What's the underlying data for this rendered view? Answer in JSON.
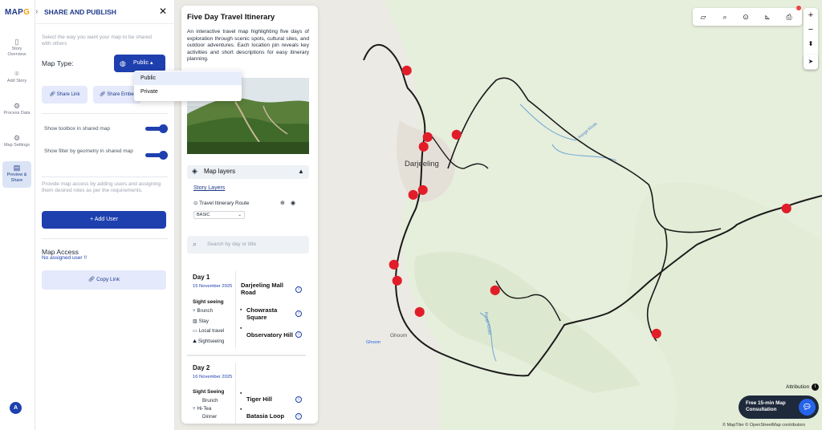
{
  "app": {
    "logo_main": "MAP",
    "logo_g": "G"
  },
  "rail": {
    "items": [
      {
        "icon": "book-icon",
        "label": "Story Overview"
      },
      {
        "icon": "pin-icon",
        "label": "Add Story"
      },
      {
        "icon": "gear-icon",
        "label": "Process Data"
      },
      {
        "icon": "settings-icon",
        "label": "Map Settings"
      },
      {
        "icon": "share-icon",
        "label": "Preview & Share"
      }
    ],
    "avatar": "A"
  },
  "share": {
    "title": "SHARE AND PUBLISH",
    "intro": "Select the way you want your map to be shared with others",
    "map_type_label": "Map Type:",
    "map_type_value": "Public",
    "share_link": "Share Link",
    "share_embed": "Share Embed",
    "toggle_toolbox": "Show toolbox in shared map",
    "toggle_filter": "Show filter by geometry in shared map",
    "access_text": "Provide map access by adding users and assigning them desired roles as per the requirements.",
    "add_user": "+ Add User",
    "map_access_title": "Map Access",
    "no_user": "No assigned user !!",
    "copy_link": "Copy Link"
  },
  "dropdown": {
    "options": [
      "Public",
      "Private"
    ],
    "selected": "Public"
  },
  "story": {
    "title": "Five Day Travel Itinerary",
    "description": "An interactive travel map highlighting five days of exploration through scenic spots, cultural sites, and outdoor adventures. Each location pin reveals key activities and short descriptions for easy itinerary planning.",
    "layers_label": "Map layers",
    "story_layers": "Story Layers",
    "layer_name": "Travel Itinerary Route",
    "basemap": "BASIC",
    "search_placeholder": "Search by day or title",
    "days": [
      {
        "title": "Day 1",
        "date": "15 November 2025",
        "type": "Sight seeing",
        "activities": [
          "Brunch",
          "Stay",
          "Local travel",
          "Sightseeing"
        ],
        "stops": [
          "Darjeeling Mall Road",
          "Chowrasta Square",
          "Observatory Hill"
        ]
      },
      {
        "title": "Day 2",
        "date": "16 November 2025",
        "type": "Sight Seeing",
        "activities": [
          "Brunch",
          "Hi-Tea",
          "Dinner"
        ],
        "stops": [
          "Tiger Hill",
          "Batasia Loop"
        ]
      }
    ]
  },
  "map": {
    "place_darjeeling": "Darjeeling",
    "place_ghoom": "Ghoom",
    "place_ghoom_small": "Ghoom",
    "river1": "Rangit Khola",
    "river2": "Rangit Khola",
    "attribution": "Attribution",
    "copyright": "© MapTiler © OpenStreetMap contributors",
    "consult": "Free 15-min Map Consultation",
    "colors": {
      "route": "#1a1a1a",
      "pin": "#e11d2a",
      "river": "#6aa6d8"
    }
  }
}
